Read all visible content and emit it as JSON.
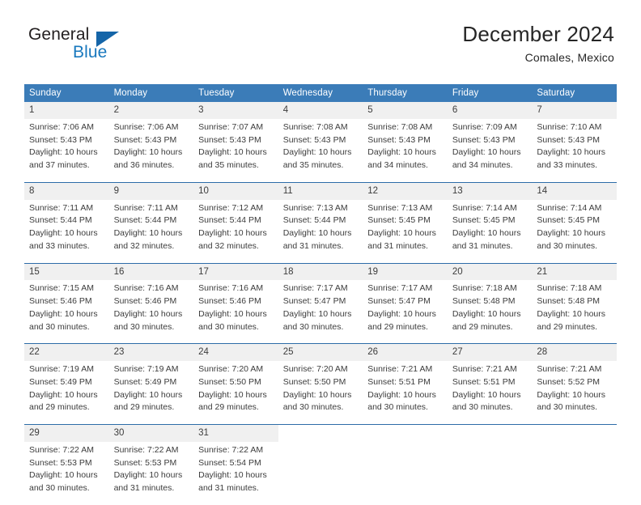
{
  "brand": {
    "name_part1": "General",
    "name_part2": "Blue",
    "logo_icon": "triangle-logo-icon"
  },
  "header": {
    "title": "December 2024",
    "location": "Comales, Mexico"
  },
  "colors": {
    "header_blue": "#3b7cb8",
    "rule_blue": "#2d6ca8",
    "date_band": "#f0f0f0",
    "brand_blue": "#1878be",
    "text": "#3c3c3c"
  },
  "weekday_headers": [
    "Sunday",
    "Monday",
    "Tuesday",
    "Wednesday",
    "Thursday",
    "Friday",
    "Saturday"
  ],
  "weeks": [
    [
      {
        "day": "1",
        "sunrise": "Sunrise: 7:06 AM",
        "sunset": "Sunset: 5:43 PM",
        "daylight1": "Daylight: 10 hours",
        "daylight2": "and 37 minutes."
      },
      {
        "day": "2",
        "sunrise": "Sunrise: 7:06 AM",
        "sunset": "Sunset: 5:43 PM",
        "daylight1": "Daylight: 10 hours",
        "daylight2": "and 36 minutes."
      },
      {
        "day": "3",
        "sunrise": "Sunrise: 7:07 AM",
        "sunset": "Sunset: 5:43 PM",
        "daylight1": "Daylight: 10 hours",
        "daylight2": "and 35 minutes."
      },
      {
        "day": "4",
        "sunrise": "Sunrise: 7:08 AM",
        "sunset": "Sunset: 5:43 PM",
        "daylight1": "Daylight: 10 hours",
        "daylight2": "and 35 minutes."
      },
      {
        "day": "5",
        "sunrise": "Sunrise: 7:08 AM",
        "sunset": "Sunset: 5:43 PM",
        "daylight1": "Daylight: 10 hours",
        "daylight2": "and 34 minutes."
      },
      {
        "day": "6",
        "sunrise": "Sunrise: 7:09 AM",
        "sunset": "Sunset: 5:43 PM",
        "daylight1": "Daylight: 10 hours",
        "daylight2": "and 34 minutes."
      },
      {
        "day": "7",
        "sunrise": "Sunrise: 7:10 AM",
        "sunset": "Sunset: 5:43 PM",
        "daylight1": "Daylight: 10 hours",
        "daylight2": "and 33 minutes."
      }
    ],
    [
      {
        "day": "8",
        "sunrise": "Sunrise: 7:11 AM",
        "sunset": "Sunset: 5:44 PM",
        "daylight1": "Daylight: 10 hours",
        "daylight2": "and 33 minutes."
      },
      {
        "day": "9",
        "sunrise": "Sunrise: 7:11 AM",
        "sunset": "Sunset: 5:44 PM",
        "daylight1": "Daylight: 10 hours",
        "daylight2": "and 32 minutes."
      },
      {
        "day": "10",
        "sunrise": "Sunrise: 7:12 AM",
        "sunset": "Sunset: 5:44 PM",
        "daylight1": "Daylight: 10 hours",
        "daylight2": "and 32 minutes."
      },
      {
        "day": "11",
        "sunrise": "Sunrise: 7:13 AM",
        "sunset": "Sunset: 5:44 PM",
        "daylight1": "Daylight: 10 hours",
        "daylight2": "and 31 minutes."
      },
      {
        "day": "12",
        "sunrise": "Sunrise: 7:13 AM",
        "sunset": "Sunset: 5:45 PM",
        "daylight1": "Daylight: 10 hours",
        "daylight2": "and 31 minutes."
      },
      {
        "day": "13",
        "sunrise": "Sunrise: 7:14 AM",
        "sunset": "Sunset: 5:45 PM",
        "daylight1": "Daylight: 10 hours",
        "daylight2": "and 31 minutes."
      },
      {
        "day": "14",
        "sunrise": "Sunrise: 7:14 AM",
        "sunset": "Sunset: 5:45 PM",
        "daylight1": "Daylight: 10 hours",
        "daylight2": "and 30 minutes."
      }
    ],
    [
      {
        "day": "15",
        "sunrise": "Sunrise: 7:15 AM",
        "sunset": "Sunset: 5:46 PM",
        "daylight1": "Daylight: 10 hours",
        "daylight2": "and 30 minutes."
      },
      {
        "day": "16",
        "sunrise": "Sunrise: 7:16 AM",
        "sunset": "Sunset: 5:46 PM",
        "daylight1": "Daylight: 10 hours",
        "daylight2": "and 30 minutes."
      },
      {
        "day": "17",
        "sunrise": "Sunrise: 7:16 AM",
        "sunset": "Sunset: 5:46 PM",
        "daylight1": "Daylight: 10 hours",
        "daylight2": "and 30 minutes."
      },
      {
        "day": "18",
        "sunrise": "Sunrise: 7:17 AM",
        "sunset": "Sunset: 5:47 PM",
        "daylight1": "Daylight: 10 hours",
        "daylight2": "and 30 minutes."
      },
      {
        "day": "19",
        "sunrise": "Sunrise: 7:17 AM",
        "sunset": "Sunset: 5:47 PM",
        "daylight1": "Daylight: 10 hours",
        "daylight2": "and 29 minutes."
      },
      {
        "day": "20",
        "sunrise": "Sunrise: 7:18 AM",
        "sunset": "Sunset: 5:48 PM",
        "daylight1": "Daylight: 10 hours",
        "daylight2": "and 29 minutes."
      },
      {
        "day": "21",
        "sunrise": "Sunrise: 7:18 AM",
        "sunset": "Sunset: 5:48 PM",
        "daylight1": "Daylight: 10 hours",
        "daylight2": "and 29 minutes."
      }
    ],
    [
      {
        "day": "22",
        "sunrise": "Sunrise: 7:19 AM",
        "sunset": "Sunset: 5:49 PM",
        "daylight1": "Daylight: 10 hours",
        "daylight2": "and 29 minutes."
      },
      {
        "day": "23",
        "sunrise": "Sunrise: 7:19 AM",
        "sunset": "Sunset: 5:49 PM",
        "daylight1": "Daylight: 10 hours",
        "daylight2": "and 29 minutes."
      },
      {
        "day": "24",
        "sunrise": "Sunrise: 7:20 AM",
        "sunset": "Sunset: 5:50 PM",
        "daylight1": "Daylight: 10 hours",
        "daylight2": "and 29 minutes."
      },
      {
        "day": "25",
        "sunrise": "Sunrise: 7:20 AM",
        "sunset": "Sunset: 5:50 PM",
        "daylight1": "Daylight: 10 hours",
        "daylight2": "and 30 minutes."
      },
      {
        "day": "26",
        "sunrise": "Sunrise: 7:21 AM",
        "sunset": "Sunset: 5:51 PM",
        "daylight1": "Daylight: 10 hours",
        "daylight2": "and 30 minutes."
      },
      {
        "day": "27",
        "sunrise": "Sunrise: 7:21 AM",
        "sunset": "Sunset: 5:51 PM",
        "daylight1": "Daylight: 10 hours",
        "daylight2": "and 30 minutes."
      },
      {
        "day": "28",
        "sunrise": "Sunrise: 7:21 AM",
        "sunset": "Sunset: 5:52 PM",
        "daylight1": "Daylight: 10 hours",
        "daylight2": "and 30 minutes."
      }
    ],
    [
      {
        "day": "29",
        "sunrise": "Sunrise: 7:22 AM",
        "sunset": "Sunset: 5:53 PM",
        "daylight1": "Daylight: 10 hours",
        "daylight2": "and 30 minutes."
      },
      {
        "day": "30",
        "sunrise": "Sunrise: 7:22 AM",
        "sunset": "Sunset: 5:53 PM",
        "daylight1": "Daylight: 10 hours",
        "daylight2": "and 31 minutes."
      },
      {
        "day": "31",
        "sunrise": "Sunrise: 7:22 AM",
        "sunset": "Sunset: 5:54 PM",
        "daylight1": "Daylight: 10 hours",
        "daylight2": "and 31 minutes."
      },
      {
        "day": "",
        "sunrise": "",
        "sunset": "",
        "daylight1": "",
        "daylight2": ""
      },
      {
        "day": "",
        "sunrise": "",
        "sunset": "",
        "daylight1": "",
        "daylight2": ""
      },
      {
        "day": "",
        "sunrise": "",
        "sunset": "",
        "daylight1": "",
        "daylight2": ""
      },
      {
        "day": "",
        "sunrise": "",
        "sunset": "",
        "daylight1": "",
        "daylight2": ""
      }
    ]
  ]
}
